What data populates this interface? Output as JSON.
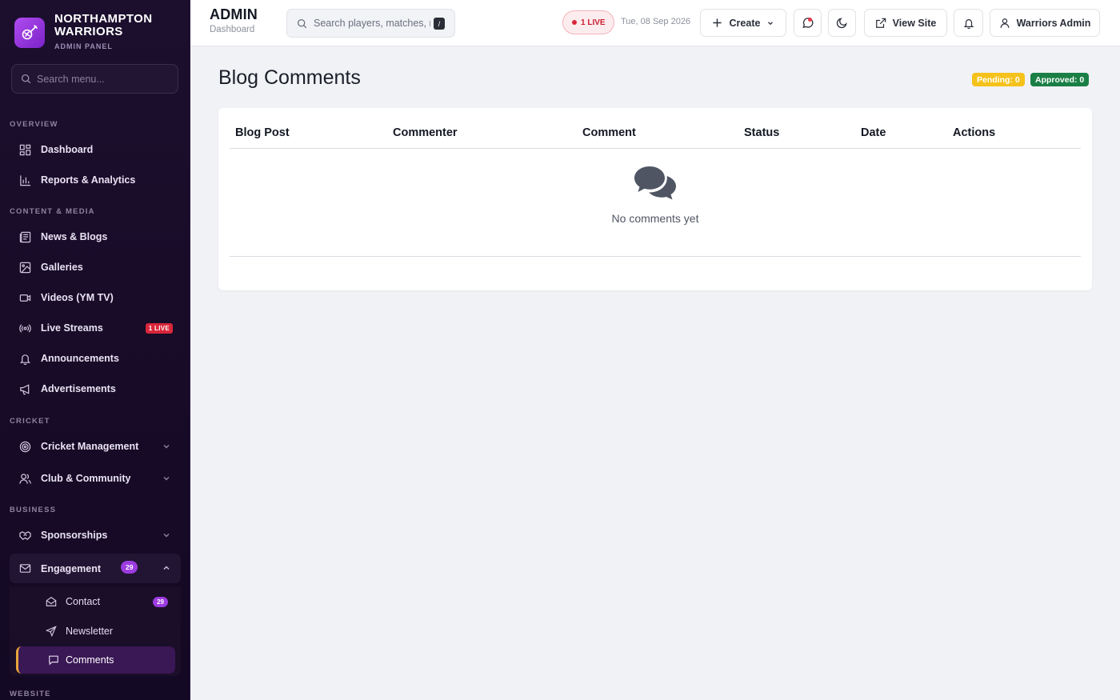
{
  "brand": {
    "name": "NORTHAMPTON WARRIORS",
    "subtitle": "ADMIN PANEL"
  },
  "sidebar_search": {
    "placeholder": "Search menu..."
  },
  "sections": {
    "overview": "OVERVIEW",
    "content": "CONTENT & MEDIA",
    "cricket": "CRICKET",
    "business": "BUSINESS",
    "website": "WEBSITE"
  },
  "nav": {
    "dashboard": "Dashboard",
    "reports": "Reports & Analytics",
    "news": "News & Blogs",
    "galleries": "Galleries",
    "videos": "Videos (YM TV)",
    "live_streams": "Live Streams",
    "live_badge": "1 LIVE",
    "announcements": "Announcements",
    "advertisements": "Advertisements",
    "cricket_management": "Cricket Management",
    "club_community": "Club & Community",
    "sponsorships": "Sponsorships",
    "engagement": "Engagement",
    "engagement_badge": "29",
    "contact": "Contact",
    "contact_badge": "29",
    "newsletter": "Newsletter",
    "comments": "Comments"
  },
  "topbar": {
    "title": "ADMIN",
    "subtitle": "Dashboard",
    "search_placeholder": "Search players, matches, news...",
    "search_shortcut": "/",
    "live_label": "1 LIVE",
    "date": "Tue, 08 Sep 2026",
    "create_label": "Create",
    "view_site_label": "View Site",
    "user_label": "Warriors Admin"
  },
  "page": {
    "title": "Blog Comments",
    "pending_label": "Pending: 0",
    "approved_label": "Approved: 0"
  },
  "table": {
    "columns": [
      "Blog Post",
      "Commenter",
      "Comment",
      "Status",
      "Date",
      "Actions"
    ],
    "empty_message": "No comments yet"
  },
  "colors": {
    "accent": "#9c3ce0",
    "live": "#d9263a",
    "pending": "#f5c21b",
    "approved": "#1a7f45",
    "sidebar_bg": "#1c0f2e"
  }
}
